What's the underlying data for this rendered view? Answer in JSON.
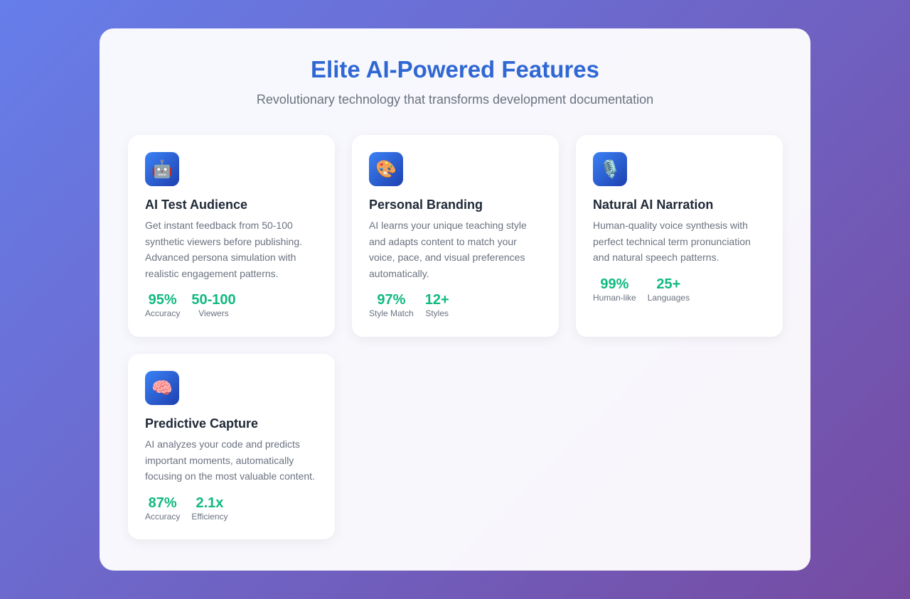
{
  "header": {
    "title": "Elite AI-Powered Features",
    "subtitle": "Revolutionary technology that transforms development documentation"
  },
  "features": [
    {
      "icon": "🤖",
      "icon_name": "robot-icon",
      "title": "AI Test Audience",
      "description": "Get instant feedback from 50-100 synthetic viewers before publishing. Advanced persona simulation with realistic engagement patterns.",
      "stats": [
        {
          "value": "95%",
          "label": "Accuracy"
        },
        {
          "value": "50-100",
          "label": "Viewers"
        }
      ]
    },
    {
      "icon": "🎨",
      "icon_name": "palette-icon",
      "title": "Personal Branding",
      "description": "AI learns your unique teaching style and adapts content to match your voice, pace, and visual preferences automatically.",
      "stats": [
        {
          "value": "97%",
          "label": "Style Match"
        },
        {
          "value": "12+",
          "label": "Styles"
        }
      ]
    },
    {
      "icon": "🎙️",
      "icon_name": "microphone-icon",
      "title": "Natural AI Narration",
      "description": "Human-quality voice synthesis with perfect technical term pronunciation and natural speech patterns.",
      "stats": [
        {
          "value": "99%",
          "label": "Human-like"
        },
        {
          "value": "25+",
          "label": "Languages"
        }
      ]
    },
    {
      "icon": "🧠",
      "icon_name": "brain-icon",
      "title": "Predictive Capture",
      "description": "AI analyzes your code and predicts important moments, automatically focusing on the most valuable content.",
      "stats": [
        {
          "value": "87%",
          "label": "Accuracy"
        },
        {
          "value": "2.1x",
          "label": "Efficiency"
        }
      ]
    }
  ],
  "colors": {
    "title": "#2f67d4",
    "stat_value": "#10b981",
    "icon_gradient_start": "#3b82f6",
    "icon_gradient_end": "#1e40af"
  }
}
